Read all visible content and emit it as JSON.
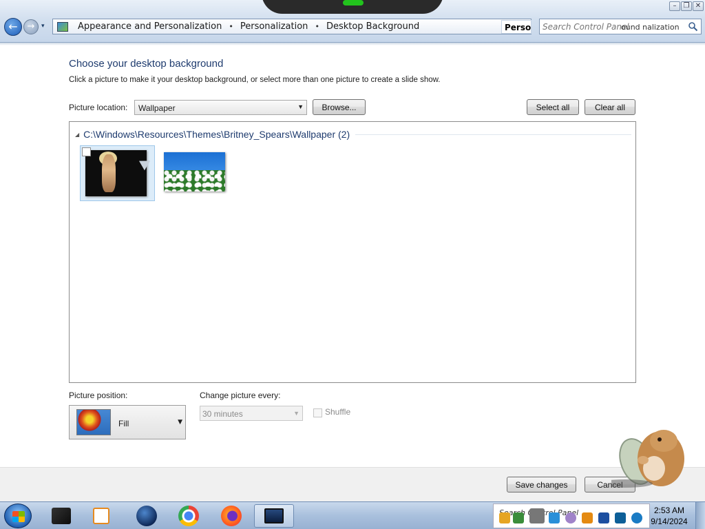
{
  "window": {
    "buttons": {
      "minimize": "–",
      "maximize": "❐",
      "close": "✕"
    }
  },
  "address": {
    "recent_pages_glyph": "▾",
    "breadcrumbs": [
      "Appearance and Personalization",
      "Personalization",
      "Desktop Background"
    ],
    "separator": "•",
    "overlay_text": "Persor",
    "refresh_glyph": "⟳"
  },
  "search": {
    "placeholder": "Search Control Panel",
    "overlay_text": "ound   nalization"
  },
  "page": {
    "title": "Choose your desktop background",
    "description": "Click a picture to make it your desktop background, or select more than one picture to create a slide show."
  },
  "picture_location": {
    "label": "Picture location:",
    "value": "Wallpaper",
    "browse_label": "Browse...",
    "select_all_label": "Select all",
    "clear_all_label": "Clear all"
  },
  "picture_group": {
    "collapse_glyph": "◢",
    "title": "C:\\Windows\\Resources\\Themes\\Britney_Spears\\Wallpaper (2)",
    "items": [
      {
        "name": "Britney Spears wallpaper",
        "selected": true,
        "checked": false
      },
      {
        "name": "Daisies wallpaper",
        "selected": false,
        "checked": false
      }
    ]
  },
  "picture_position": {
    "label": "Picture position:",
    "value": "Fill"
  },
  "change_picture": {
    "label": "Change picture every:",
    "value": "30 minutes",
    "enabled": false
  },
  "shuffle": {
    "label": "Shuffle",
    "checked": false,
    "enabled": false
  },
  "footer": {
    "save_label": "Save changes",
    "cancel_label": "Cancel"
  },
  "taskbar": {
    "apps": [
      "windows-explorer-icon",
      "media-player-icon",
      "globe-browser-icon",
      "chrome-icon",
      "firefox-icon",
      "control-panel-icon"
    ],
    "tray_search": "Search Control Panel",
    "clock_time": "2:53 AM",
    "clock_date": "9/14/2024"
  },
  "colors": {
    "title_blue": "#1e3b6e",
    "selection_blue": "#dcecf9",
    "taskbar": "#a9c0dd"
  }
}
